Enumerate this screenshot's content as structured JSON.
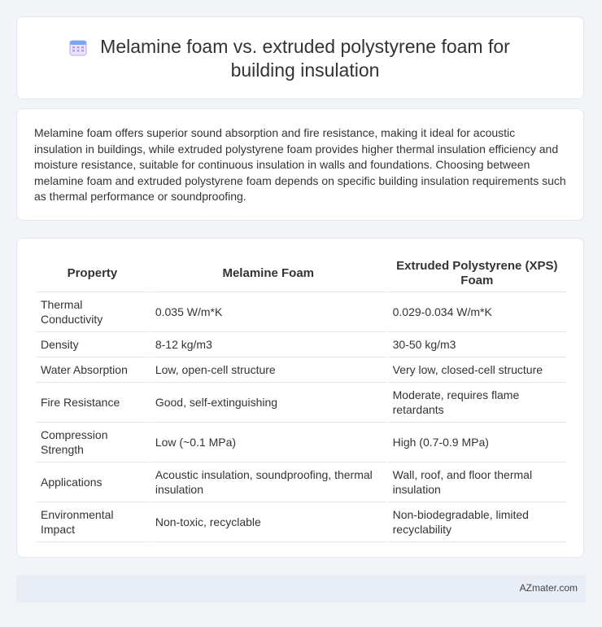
{
  "header": {
    "title": "Melamine foam vs. extruded polystyrene foam for building insulation",
    "icon": "calendar-icon"
  },
  "summary": "Melamine foam offers superior sound absorption and fire resistance, making it ideal for acoustic insulation in buildings, while extruded polystyrene foam provides higher thermal insulation efficiency and moisture resistance, suitable for continuous insulation in walls and foundations. Choosing between melamine foam and extruded polystyrene foam depends on specific building insulation requirements such as thermal performance or soundproofing.",
  "table": {
    "headers": [
      "Property",
      "Melamine Foam",
      "Extruded Polystyrene (XPS) Foam"
    ],
    "rows": [
      [
        "Thermal Conductivity",
        "0.035 W/m*K",
        "0.029-0.034 W/m*K"
      ],
      [
        "Density",
        "8-12 kg/m3",
        "30-50 kg/m3"
      ],
      [
        "Water Absorption",
        "Low, open-cell structure",
        "Very low, closed-cell structure"
      ],
      [
        "Fire Resistance",
        "Good, self-extinguishing",
        "Moderate, requires flame retardants"
      ],
      [
        "Compression Strength",
        "Low (~0.1 MPa)",
        "High (0.7-0.9 MPa)"
      ],
      [
        "Applications",
        "Acoustic insulation, soundproofing, thermal insulation",
        "Wall, roof, and floor thermal insulation"
      ],
      [
        "Environmental Impact",
        "Non-toxic, recyclable",
        "Non-biodegradable, limited recyclability"
      ]
    ]
  },
  "footer": {
    "brand": "AZmater.com"
  },
  "colors": {
    "background": "#f2f4f8",
    "card": "#ffffff",
    "footer": "#e8edf6",
    "icon_accent": "#a78bfa"
  }
}
